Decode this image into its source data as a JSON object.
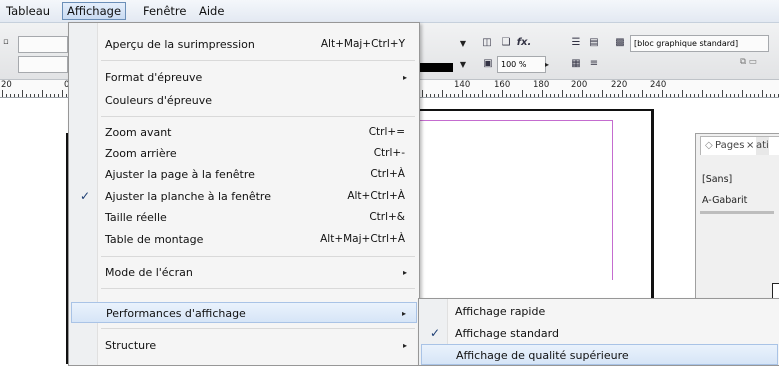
{
  "menubar": {
    "items": [
      {
        "label": "Tableau"
      },
      {
        "label": "Affichage"
      },
      {
        "label": "Fenêtre"
      },
      {
        "label": "Aide"
      }
    ]
  },
  "toolbar": {
    "zoom_value": "100 %",
    "fx_label": "fx.",
    "style_value": "[bloc graphique standard]"
  },
  "ruler": {
    "numbers": [
      "20",
      "0",
      "140",
      "160",
      "180",
      "200",
      "220",
      "240"
    ]
  },
  "pages_panel": {
    "tab_label": "Pages",
    "tab_close": "×",
    "tab_next": "ati",
    "row_none": "[Sans]",
    "row_master": "A-Gabarit"
  },
  "menu": {
    "items": [
      {
        "label": "Aperçu de la surimpression",
        "shortcut": "Alt+Maj+Ctrl+Y"
      },
      {
        "label": "Format d'épreuve",
        "submenu": true
      },
      {
        "label": "Couleurs d'épreuve"
      },
      {
        "label": "Zoom avant",
        "shortcut": "Ctrl+="
      },
      {
        "label": "Zoom arrière",
        "shortcut": "Ctrl+-"
      },
      {
        "label": "Ajuster la page à la fenêtre",
        "shortcut": "Ctrl+À"
      },
      {
        "label": "Ajuster la planche à la fenêtre",
        "shortcut": "Alt+Ctrl+À",
        "checked": true
      },
      {
        "label": "Taille réelle",
        "shortcut": "Ctrl+&"
      },
      {
        "label": "Table de montage",
        "shortcut": "Alt+Maj+Ctrl+À"
      },
      {
        "label": "Mode de l'écran",
        "submenu": true
      },
      {
        "label": "Performances d'affichage",
        "submenu": true,
        "highlighted": true
      },
      {
        "label": "Structure",
        "submenu": true
      }
    ],
    "check_mark": "✓",
    "arrow_mark": "▸"
  },
  "submenu": {
    "items": [
      {
        "label": "Affichage rapide"
      },
      {
        "label": "Affichage standard",
        "checked": true
      },
      {
        "label": "Affichage de qualité supérieure"
      }
    ]
  }
}
